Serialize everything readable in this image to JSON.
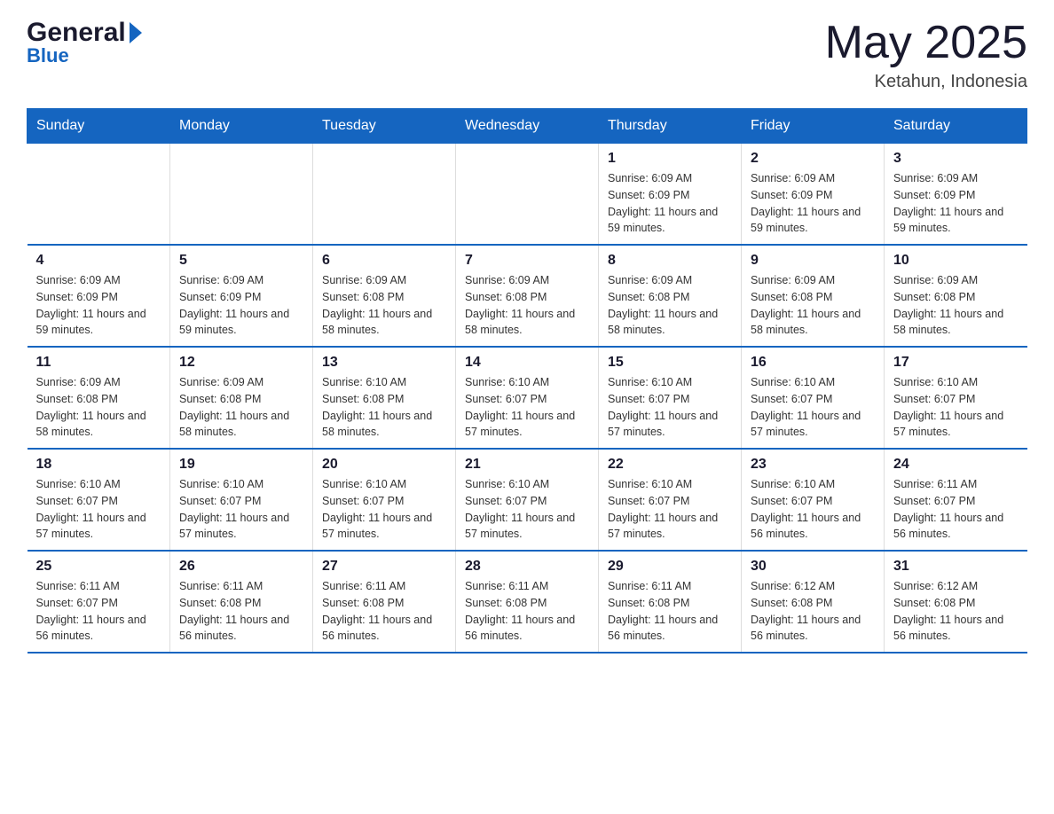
{
  "header": {
    "logo_general": "General",
    "logo_blue": "Blue",
    "title": "May 2025",
    "subtitle": "Ketahun, Indonesia"
  },
  "weekdays": [
    "Sunday",
    "Monday",
    "Tuesday",
    "Wednesday",
    "Thursday",
    "Friday",
    "Saturday"
  ],
  "weeks": [
    [
      {
        "day": "",
        "info": ""
      },
      {
        "day": "",
        "info": ""
      },
      {
        "day": "",
        "info": ""
      },
      {
        "day": "",
        "info": ""
      },
      {
        "day": "1",
        "info": "Sunrise: 6:09 AM\nSunset: 6:09 PM\nDaylight: 11 hours and 59 minutes."
      },
      {
        "day": "2",
        "info": "Sunrise: 6:09 AM\nSunset: 6:09 PM\nDaylight: 11 hours and 59 minutes."
      },
      {
        "day": "3",
        "info": "Sunrise: 6:09 AM\nSunset: 6:09 PM\nDaylight: 11 hours and 59 minutes."
      }
    ],
    [
      {
        "day": "4",
        "info": "Sunrise: 6:09 AM\nSunset: 6:09 PM\nDaylight: 11 hours and 59 minutes."
      },
      {
        "day": "5",
        "info": "Sunrise: 6:09 AM\nSunset: 6:09 PM\nDaylight: 11 hours and 59 minutes."
      },
      {
        "day": "6",
        "info": "Sunrise: 6:09 AM\nSunset: 6:08 PM\nDaylight: 11 hours and 58 minutes."
      },
      {
        "day": "7",
        "info": "Sunrise: 6:09 AM\nSunset: 6:08 PM\nDaylight: 11 hours and 58 minutes."
      },
      {
        "day": "8",
        "info": "Sunrise: 6:09 AM\nSunset: 6:08 PM\nDaylight: 11 hours and 58 minutes."
      },
      {
        "day": "9",
        "info": "Sunrise: 6:09 AM\nSunset: 6:08 PM\nDaylight: 11 hours and 58 minutes."
      },
      {
        "day": "10",
        "info": "Sunrise: 6:09 AM\nSunset: 6:08 PM\nDaylight: 11 hours and 58 minutes."
      }
    ],
    [
      {
        "day": "11",
        "info": "Sunrise: 6:09 AM\nSunset: 6:08 PM\nDaylight: 11 hours and 58 minutes."
      },
      {
        "day": "12",
        "info": "Sunrise: 6:09 AM\nSunset: 6:08 PM\nDaylight: 11 hours and 58 minutes."
      },
      {
        "day": "13",
        "info": "Sunrise: 6:10 AM\nSunset: 6:08 PM\nDaylight: 11 hours and 58 minutes."
      },
      {
        "day": "14",
        "info": "Sunrise: 6:10 AM\nSunset: 6:07 PM\nDaylight: 11 hours and 57 minutes."
      },
      {
        "day": "15",
        "info": "Sunrise: 6:10 AM\nSunset: 6:07 PM\nDaylight: 11 hours and 57 minutes."
      },
      {
        "day": "16",
        "info": "Sunrise: 6:10 AM\nSunset: 6:07 PM\nDaylight: 11 hours and 57 minutes."
      },
      {
        "day": "17",
        "info": "Sunrise: 6:10 AM\nSunset: 6:07 PM\nDaylight: 11 hours and 57 minutes."
      }
    ],
    [
      {
        "day": "18",
        "info": "Sunrise: 6:10 AM\nSunset: 6:07 PM\nDaylight: 11 hours and 57 minutes."
      },
      {
        "day": "19",
        "info": "Sunrise: 6:10 AM\nSunset: 6:07 PM\nDaylight: 11 hours and 57 minutes."
      },
      {
        "day": "20",
        "info": "Sunrise: 6:10 AM\nSunset: 6:07 PM\nDaylight: 11 hours and 57 minutes."
      },
      {
        "day": "21",
        "info": "Sunrise: 6:10 AM\nSunset: 6:07 PM\nDaylight: 11 hours and 57 minutes."
      },
      {
        "day": "22",
        "info": "Sunrise: 6:10 AM\nSunset: 6:07 PM\nDaylight: 11 hours and 57 minutes."
      },
      {
        "day": "23",
        "info": "Sunrise: 6:10 AM\nSunset: 6:07 PM\nDaylight: 11 hours and 56 minutes."
      },
      {
        "day": "24",
        "info": "Sunrise: 6:11 AM\nSunset: 6:07 PM\nDaylight: 11 hours and 56 minutes."
      }
    ],
    [
      {
        "day": "25",
        "info": "Sunrise: 6:11 AM\nSunset: 6:07 PM\nDaylight: 11 hours and 56 minutes."
      },
      {
        "day": "26",
        "info": "Sunrise: 6:11 AM\nSunset: 6:08 PM\nDaylight: 11 hours and 56 minutes."
      },
      {
        "day": "27",
        "info": "Sunrise: 6:11 AM\nSunset: 6:08 PM\nDaylight: 11 hours and 56 minutes."
      },
      {
        "day": "28",
        "info": "Sunrise: 6:11 AM\nSunset: 6:08 PM\nDaylight: 11 hours and 56 minutes."
      },
      {
        "day": "29",
        "info": "Sunrise: 6:11 AM\nSunset: 6:08 PM\nDaylight: 11 hours and 56 minutes."
      },
      {
        "day": "30",
        "info": "Sunrise: 6:12 AM\nSunset: 6:08 PM\nDaylight: 11 hours and 56 minutes."
      },
      {
        "day": "31",
        "info": "Sunrise: 6:12 AM\nSunset: 6:08 PM\nDaylight: 11 hours and 56 minutes."
      }
    ]
  ]
}
